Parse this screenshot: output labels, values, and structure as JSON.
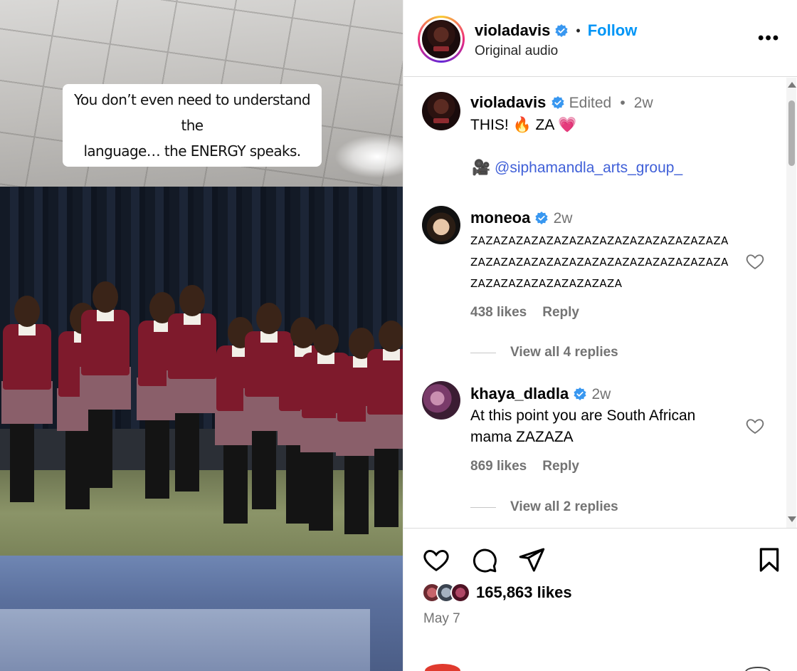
{
  "video": {
    "caption_line1": "You don’t even need to understand the",
    "caption_line2": "language… the ENERGY speaks."
  },
  "header": {
    "username": "violadavis",
    "separator": "•",
    "follow_label": "Follow",
    "subtitle": "Original audio",
    "more_label": "•••",
    "verified_color": "#3897f0",
    "ring_colors": [
      "#f9ce34",
      "#ee2a7b",
      "#6228d7"
    ]
  },
  "post": {
    "username": "violadavis",
    "edited": "Edited",
    "separator": "•",
    "time": "2w",
    "text": "THIS! 🔥 ZA 💗",
    "credit_icon": "🎥",
    "mention": "@siphamandla_arts_group_"
  },
  "comments": [
    {
      "username": "moneoa",
      "time": "2w",
      "text_lines": [
        "ZAZAZAZAZAZAZAZAZAZAZAZAZAZAZAZAZA",
        "ZAZAZAZAZAZAZAZAZAZAZAZAZAZAZAZAZA",
        "ZAZAZAZAZAZAZAZAZAZA"
      ],
      "likes": "438 likes",
      "reply": "Reply",
      "view_replies": "View all 4 replies"
    },
    {
      "username": "khaya_dladla",
      "time": "2w",
      "text_line1": "At this point you are South African",
      "text_line2": "mama ZAZAZA",
      "likes": "869 likes",
      "reply": "Reply",
      "view_replies": "View all 2 replies"
    }
  ],
  "actions": {
    "likes_count": "165,863 likes",
    "date": "May 7"
  },
  "colors": {
    "accent": "#0095f6",
    "muted": "#737373",
    "link": "#4060d8"
  }
}
